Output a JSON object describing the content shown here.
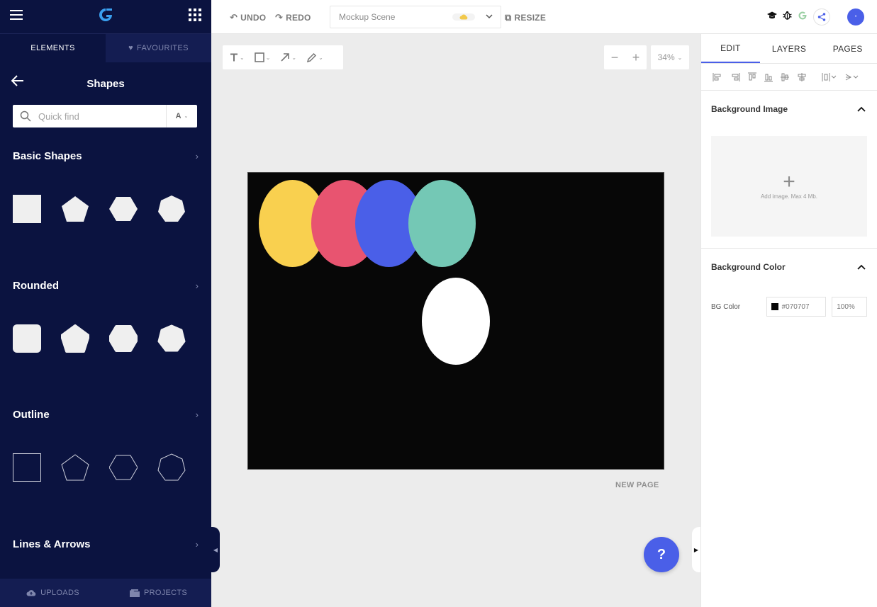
{
  "sidebar": {
    "tabs": [
      {
        "label": "ELEMENTS"
      },
      {
        "label": "FAVOURITES"
      }
    ],
    "title": "Shapes",
    "search": {
      "placeholder": "Quick find",
      "filter": "A"
    },
    "sections": [
      {
        "label": "Basic Shapes"
      },
      {
        "label": "Rounded"
      },
      {
        "label": "Outline"
      },
      {
        "label": "Lines & Arrows"
      }
    ],
    "bottom": [
      {
        "label": "UPLOADS"
      },
      {
        "label": "PROJECTS"
      }
    ]
  },
  "topbar": {
    "undo": "UNDO",
    "redo": "REDO",
    "scene_name": "Mockup Scene",
    "resize": "RESIZE"
  },
  "zoom": {
    "value": "34%"
  },
  "canvas": {
    "background": "#070707",
    "ellipses": [
      {
        "color": "#f9d04f"
      },
      {
        "color": "#e85470"
      },
      {
        "color": "#4a5fe8"
      },
      {
        "color": "#74c8b5"
      },
      {
        "color": "#ffffff"
      }
    ],
    "new_page": "NEW PAGE"
  },
  "help": "?",
  "right_panel": {
    "tabs": [
      {
        "label": "EDIT"
      },
      {
        "label": "LAYERS"
      },
      {
        "label": "PAGES"
      }
    ],
    "bg_image": {
      "title": "Background Image",
      "hint": "Add image. Max 4 Mb."
    },
    "bg_color": {
      "title": "Background Color",
      "label": "BG Color",
      "value": "#070707",
      "opacity": "100%"
    }
  },
  "colors": {
    "sidebar": "#0b1340",
    "accent": "#4a5fe8"
  }
}
